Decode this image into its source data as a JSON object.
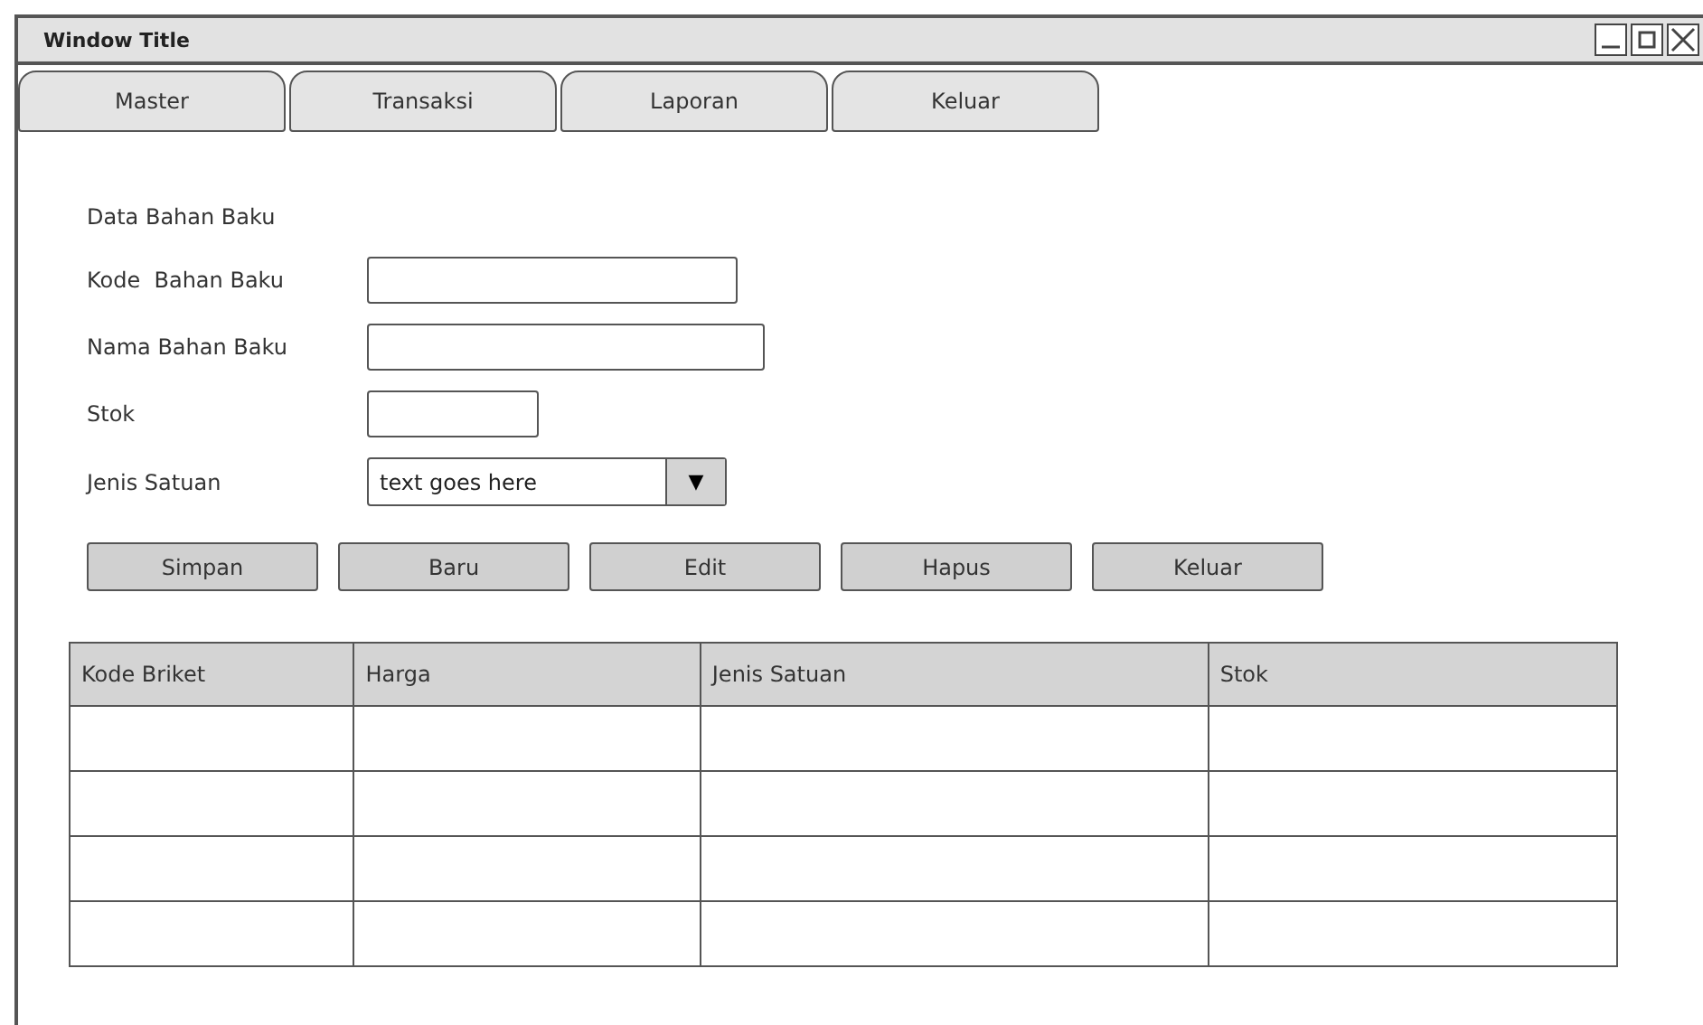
{
  "window": {
    "title": "Window Title"
  },
  "tabs": [
    {
      "label": "Master",
      "selected": false
    },
    {
      "label": "Transaksi",
      "selected": false
    },
    {
      "label": "Laporan",
      "selected": false
    },
    {
      "label": "Keluar",
      "selected": false
    }
  ],
  "form": {
    "heading": "Data Bahan Baku",
    "fields": [
      {
        "kind": "input",
        "label": "Kode  Bahan Baku"
      },
      {
        "kind": "input",
        "label": "Nama Bahan Baku"
      },
      {
        "kind": "input",
        "label": "Stok"
      },
      {
        "kind": "select",
        "label": "Jenis Satuan",
        "value": "text goes here",
        "arrow": "▼"
      }
    ]
  },
  "buttons": [
    "Simpan",
    "Baru",
    "Edit",
    "Hapus",
    "Keluar"
  ],
  "table": {
    "columns": [
      "Kode Briket",
      "Harga",
      "Jenis Satuan",
      "Stok"
    ]
  }
}
